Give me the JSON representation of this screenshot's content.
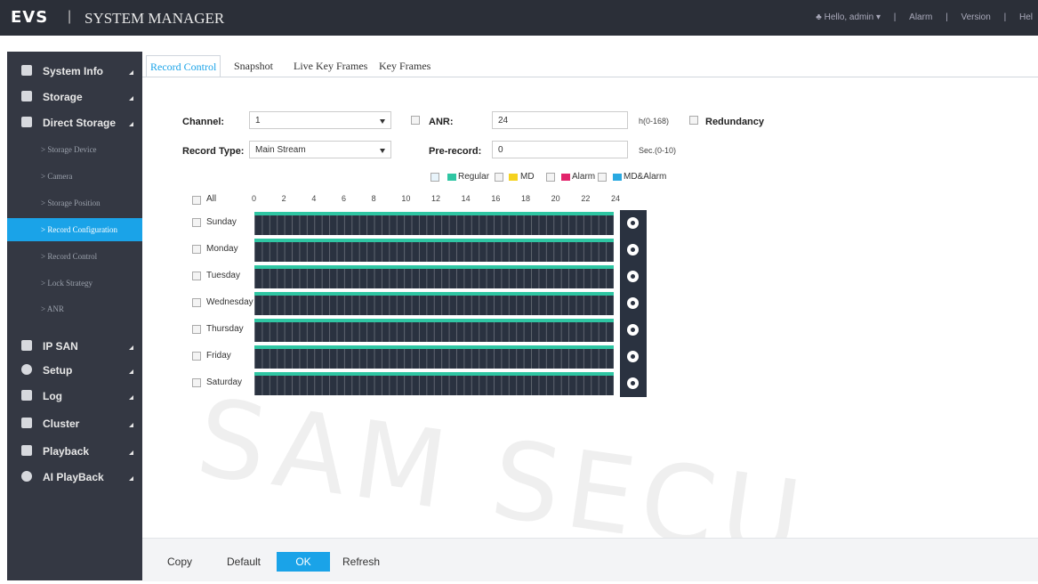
{
  "header": {
    "logo": "EVS",
    "separator": "|",
    "title": "SYSTEM MANAGER",
    "user": "♣ Hello, admin ▾",
    "links": [
      "|",
      "Alarm",
      "|",
      "Version",
      "|",
      "Hel"
    ]
  },
  "sidebar": {
    "items": [
      {
        "label": "System Info"
      },
      {
        "label": "Storage"
      },
      {
        "label": "Direct Storage"
      },
      {
        "label": "IP SAN"
      },
      {
        "label": "Setup"
      },
      {
        "label": "Log"
      },
      {
        "label": "Cluster"
      },
      {
        "label": "Playback"
      },
      {
        "label": "AI PlayBack"
      }
    ],
    "subitems": [
      {
        "label": "> Storage Device"
      },
      {
        "label": "> Camera"
      },
      {
        "label": "> Storage Position"
      },
      {
        "label": "> Record Configuration"
      },
      {
        "label": "> Record Control"
      },
      {
        "label": "> Lock Strategy"
      },
      {
        "label": "> ANR"
      }
    ]
  },
  "tabs": [
    "Record Control",
    "Snapshot",
    "Live Key Frames",
    "Key Frames"
  ],
  "form": {
    "channel_label": "Channel:",
    "channel_value": "1",
    "anr_label": "ANR:",
    "anr_value": "24",
    "anr_unit": "h(0-168)",
    "redundancy_label": "Redundancy",
    "record_type_label": "Record Type:",
    "record_type_value": "Main Stream",
    "prerecord_label": "Pre-record:",
    "prerecord_value": "0",
    "prerecord_unit": "Sec.(0-10)"
  },
  "legend": [
    {
      "label": "Regular",
      "color": "#2fc6a3"
    },
    {
      "label": "MD",
      "color": "#f5d21f"
    },
    {
      "label": "Alarm",
      "color": "#e2246b"
    },
    {
      "label": "MD&Alarm",
      "color": "#29a9e1"
    }
  ],
  "schedule": {
    "all_label": "All",
    "hours": [
      "0",
      "2",
      "4",
      "6",
      "8",
      "10",
      "12",
      "14",
      "16",
      "18",
      "20",
      "22",
      "24"
    ],
    "days": [
      "Sunday",
      "Monday",
      "Tuesday",
      "Wednesday",
      "Thursday",
      "Friday",
      "Saturday"
    ]
  },
  "buttons": {
    "copy": "Copy",
    "default": "Default",
    "ok": "OK",
    "refresh": "Refresh"
  },
  "watermark": "SAM SECU"
}
